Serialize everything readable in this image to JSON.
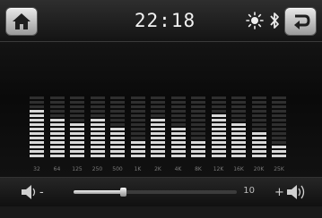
{
  "header": {
    "clock": "22:18",
    "icons": [
      "home-icon",
      "brightness-icon",
      "bluetooth-icon",
      "back-icon"
    ]
  },
  "equalizer": {
    "band_labels": [
      "32",
      "64",
      "125",
      "250",
      "500",
      "1K",
      "2K",
      "4K",
      "8K",
      "12K",
      "16K",
      "20K",
      "25K"
    ],
    "levels": [
      11,
      9,
      8,
      9,
      7,
      4,
      9,
      7,
      4,
      10,
      8,
      6,
      3
    ],
    "max_level": 14,
    "colors": {
      "active": "#d9d9d9",
      "inactive": "#2f2f2f"
    }
  },
  "volume": {
    "down_label": "-",
    "up_label": "+",
    "value": "10",
    "level_fraction": 0.3
  }
}
